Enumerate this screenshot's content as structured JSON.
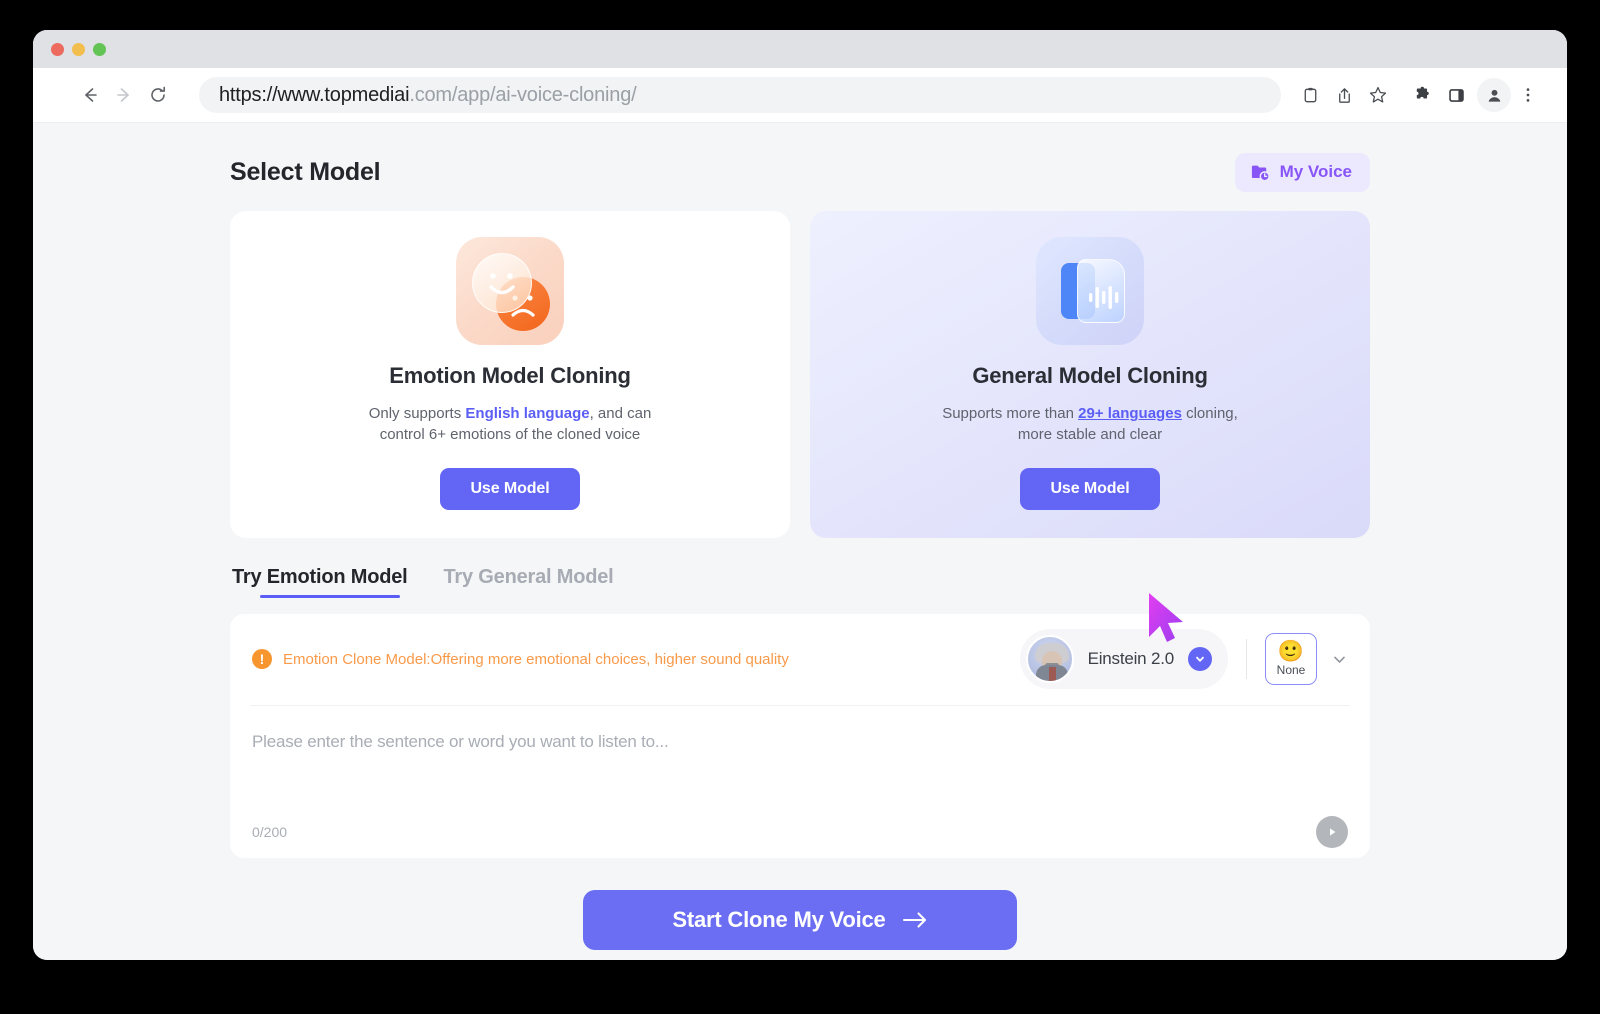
{
  "browser": {
    "url_strong": "https://www.topmediai",
    "url_rest": ".com/app/ai-voice-cloning/",
    "back_icon": "back-arrow-icon",
    "forward_icon": "forward-arrow-icon",
    "reload_icon": "reload-icon",
    "toolbar_icons": [
      "clipboard-icon",
      "share-icon",
      "bookmark-star-icon",
      "extensions-puzzle-icon",
      "side-panel-icon",
      "profile-avatar-icon",
      "menu-kebab-icon"
    ],
    "window_controls": [
      "close-red",
      "minimize-yellow",
      "maximize-green"
    ]
  },
  "header": {
    "title": "Select Model",
    "my_voice_label": "My Voice",
    "my_voice_icon": "folder-clock-icon",
    "accent": "#8855f7"
  },
  "cards": [
    {
      "key": "emotion",
      "icon": "emotion-faces-icon",
      "title": "Emotion Model Cloning",
      "desc_pre": "Only supports ",
      "desc_link": "English language",
      "desc_post": ", and can control 6+ emotions of the cloned voice",
      "button_label": "Use Model"
    },
    {
      "key": "general",
      "icon": "waveform-document-icon",
      "title": "General Model Cloning",
      "desc_pre": "Supports more than ",
      "desc_link": "29+ languages",
      "desc_post": " cloning, more stable and clear",
      "button_label": "Use Model"
    }
  ],
  "tabs": [
    {
      "prefix": "Try",
      "label": "Emotion Model",
      "active": true
    },
    {
      "prefix": "Try",
      "label": "General Model",
      "active": false
    }
  ],
  "editor": {
    "notice_icon": "warning-exclamation-icon",
    "notice_text": "Emotion Clone Model:Offering more emotional choices, higher sound quality",
    "notice_color": "#f89a4a",
    "voice_name": "Einstein 2.0",
    "voice_avatar": "einstein-avatar",
    "voice_chevron_icon": "chevron-down-icon",
    "emotion_emoji": "🙂",
    "emotion_label": "None",
    "emotion_chevron_icon": "chevron-down-icon",
    "placeholder": "Please enter the sentence or word you want to listen to...",
    "counter": "0/200",
    "play_icon": "play-icon"
  },
  "cta": {
    "label": "Start Clone My Voice",
    "arrow_icon": "arrow-right-icon",
    "color": "#6b6ef2"
  },
  "cursor": {
    "icon": "mouse-pointer-icon",
    "color": "#c83cf0"
  }
}
